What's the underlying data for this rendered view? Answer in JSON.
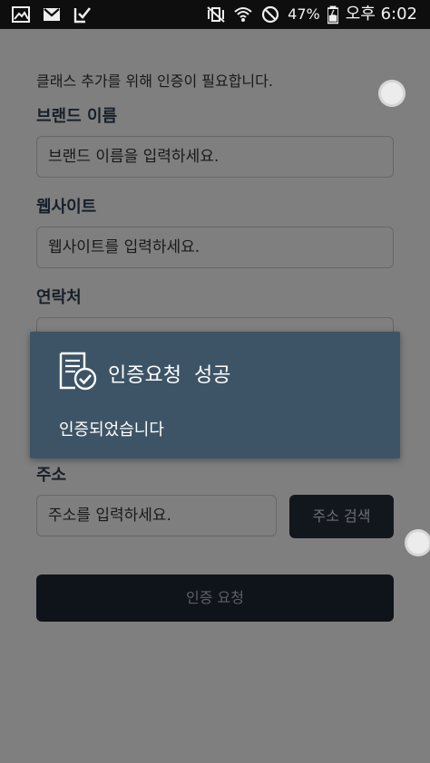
{
  "status_bar": {
    "battery_percent": "47%",
    "time": "오후 6:02"
  },
  "form": {
    "intro": "클래스 추가를 위해 인증이 필요합니다.",
    "brand_label": "브랜드 이름",
    "brand_placeholder": "브랜드 이름을 입력하세요.",
    "website_label": "웹사이트",
    "website_placeholder": "웹사이트를 입력하세요.",
    "contact_label": "연락처",
    "address_label": "주소",
    "address_placeholder": "주소를 입력하세요.",
    "address_search_button": "주소 검색",
    "submit_button": "인증 요청"
  },
  "toast": {
    "icon": "certificate-check-icon",
    "title": "인증요청  성공",
    "message": "인증되었습니다"
  },
  "colors": {
    "toast_bg": "#3d5466",
    "button_dark": "#242e3a",
    "label": "#2f3f52"
  }
}
